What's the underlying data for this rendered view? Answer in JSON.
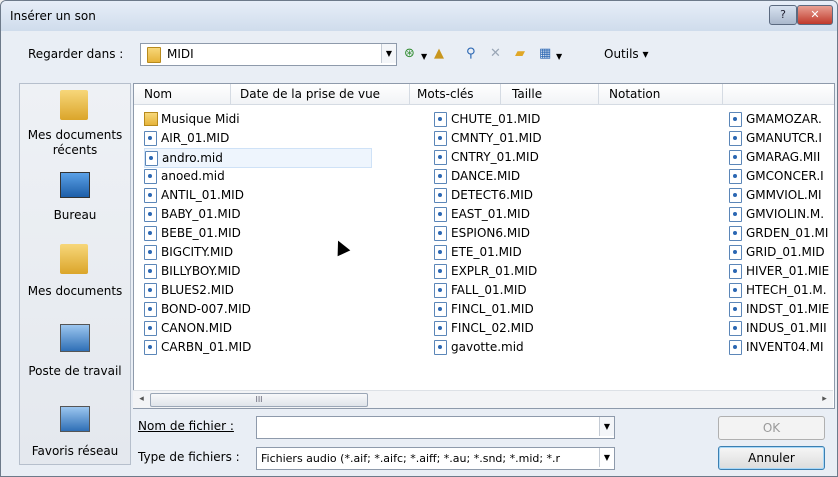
{
  "window": {
    "title": "Insérer un son",
    "help_label": "?",
    "close_label": "✕"
  },
  "toolbar": {
    "look_in_label": "Regarder dans :",
    "look_in_value": "MIDI",
    "icons": [
      "back-icon",
      "up-folder-icon",
      "search-web-icon",
      "delete-icon",
      "new-folder-icon",
      "views-icon"
    ],
    "tools_label": "Outils ▾"
  },
  "places": [
    {
      "label": "Mes documents récents",
      "icon": "recent-docs-icon"
    },
    {
      "label": "Bureau",
      "icon": "desktop-icon"
    },
    {
      "label": "Mes documents",
      "icon": "my-documents-icon"
    },
    {
      "label": "Poste de travail",
      "icon": "computer-icon"
    },
    {
      "label": "Favoris réseau",
      "icon": "network-icon"
    }
  ],
  "columns": [
    "Nom",
    "Date de la prise de vue",
    "Mots-clés",
    "Taille",
    "Notation"
  ],
  "files": {
    "col1": [
      "Musique Midi",
      "AIR_01.MID",
      "andro.mid",
      "anoed.mid",
      "ANTIL_01.MID",
      "BABY_01.MID",
      "BEBE_01.MID",
      "BIGCITY.MID",
      "BILLYBOY.MID",
      "BLUES2.MID",
      "BOND-007.MID",
      "CANON.MID",
      "CARBN_01.MID"
    ],
    "col2": [
      "CHUTE_01.MID",
      "CMNTY_01.MID",
      "CNTRY_01.MID",
      "DANCE.MID",
      "DETECT6.MID",
      "EAST_01.MID",
      "ESPION6.MID",
      "ETE_01.MID",
      "EXPLR_01.MID",
      "FALL_01.MID",
      "FINCL_01.MID",
      "FINCL_02.MID",
      "gavotte.mid"
    ],
    "col3": [
      "GMAMOZAR.",
      "GMANUTCR.I",
      "GMARAG.MII",
      "GMCONCER.I",
      "GMMVIOL.MI",
      "GMVIOLIN.M.",
      "GRDEN_01.MI",
      "GRID_01.MID",
      "HIVER_01.MIE",
      "HTECH_01.M.",
      "INDST_01.MIE",
      "INDUS_01.MII",
      "INVENT04.MI"
    ]
  },
  "scrollbar": {
    "left": "◂",
    "right": "▸",
    "thumb": "III"
  },
  "form": {
    "filename_label": "Nom de fichier :",
    "filename_value": "",
    "filetype_label": "Type de fichiers :",
    "filetype_value": "Fichiers audio (*.aif; *.aifc; *.aiff; *.au; *.snd; *.mid; *.r",
    "ok_label": "OK",
    "cancel_label": "Annuler"
  }
}
